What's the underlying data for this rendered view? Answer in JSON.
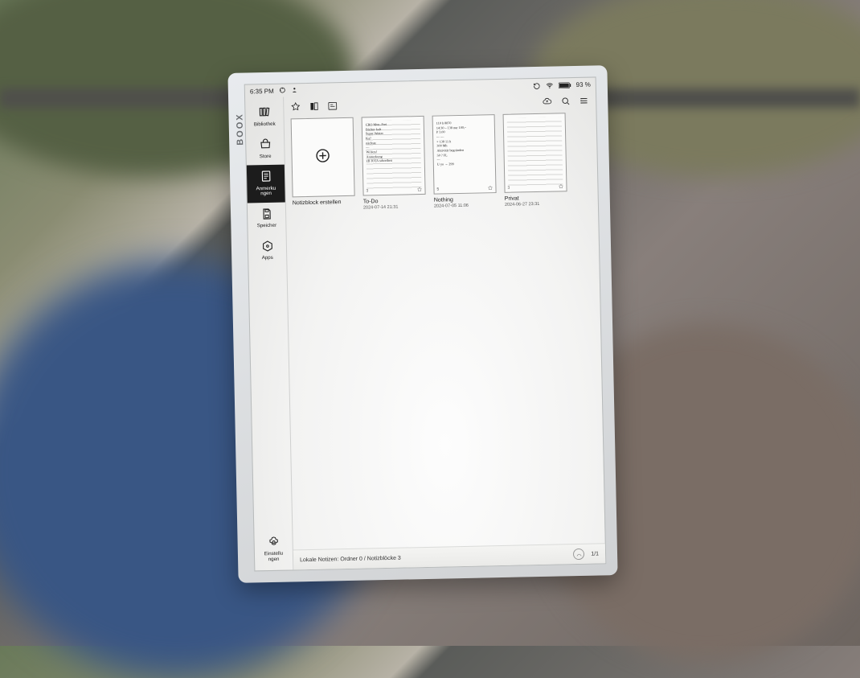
{
  "brand": "BOOX",
  "status": {
    "time": "6:35 PM",
    "battery": "93 %"
  },
  "sidebar": {
    "items": [
      {
        "key": "bibliothek",
        "label": "Bibliothek"
      },
      {
        "key": "store",
        "label": "Store"
      },
      {
        "key": "anmerkungen",
        "label": "Anmerku\nngen"
      },
      {
        "key": "speicher",
        "label": "Speicher"
      },
      {
        "key": "apps",
        "label": "Apps"
      },
      {
        "key": "einstellungen",
        "label": "Einstellu\nngen"
      }
    ],
    "active_key": "anmerkungen"
  },
  "notes": {
    "new_label": "Notizblock erstellen",
    "items": [
      {
        "title": "To-Do",
        "date": "2024-07-14 21:31",
        "pages": "3",
        "scribble": "CRO Mon–Frei\nBäcker kalt\nSuper Wetter\nKa?\nnächste\n—\nWriters!\nAnmerkung\nzB IOTA schreiben"
      },
      {
        "title": "Nothing",
        "date": "2024-07-05 11:06",
        "pages": "5",
        "scribble": "110 h  8870\n14:30 – 138     nur 100,–\nP 3.00\n— —\n× 138  11 h\n300 Mh\nAktivität begründen\n50 ? FL\n—\nU yo → 299"
      },
      {
        "title": "Privat",
        "date": "2024-06-27 23:31",
        "pages": "3",
        "scribble": ""
      }
    ]
  },
  "footer": {
    "summary": "Lokale Notizen: Ordner 0 / Notizblöcke 3",
    "page": "1/1"
  }
}
